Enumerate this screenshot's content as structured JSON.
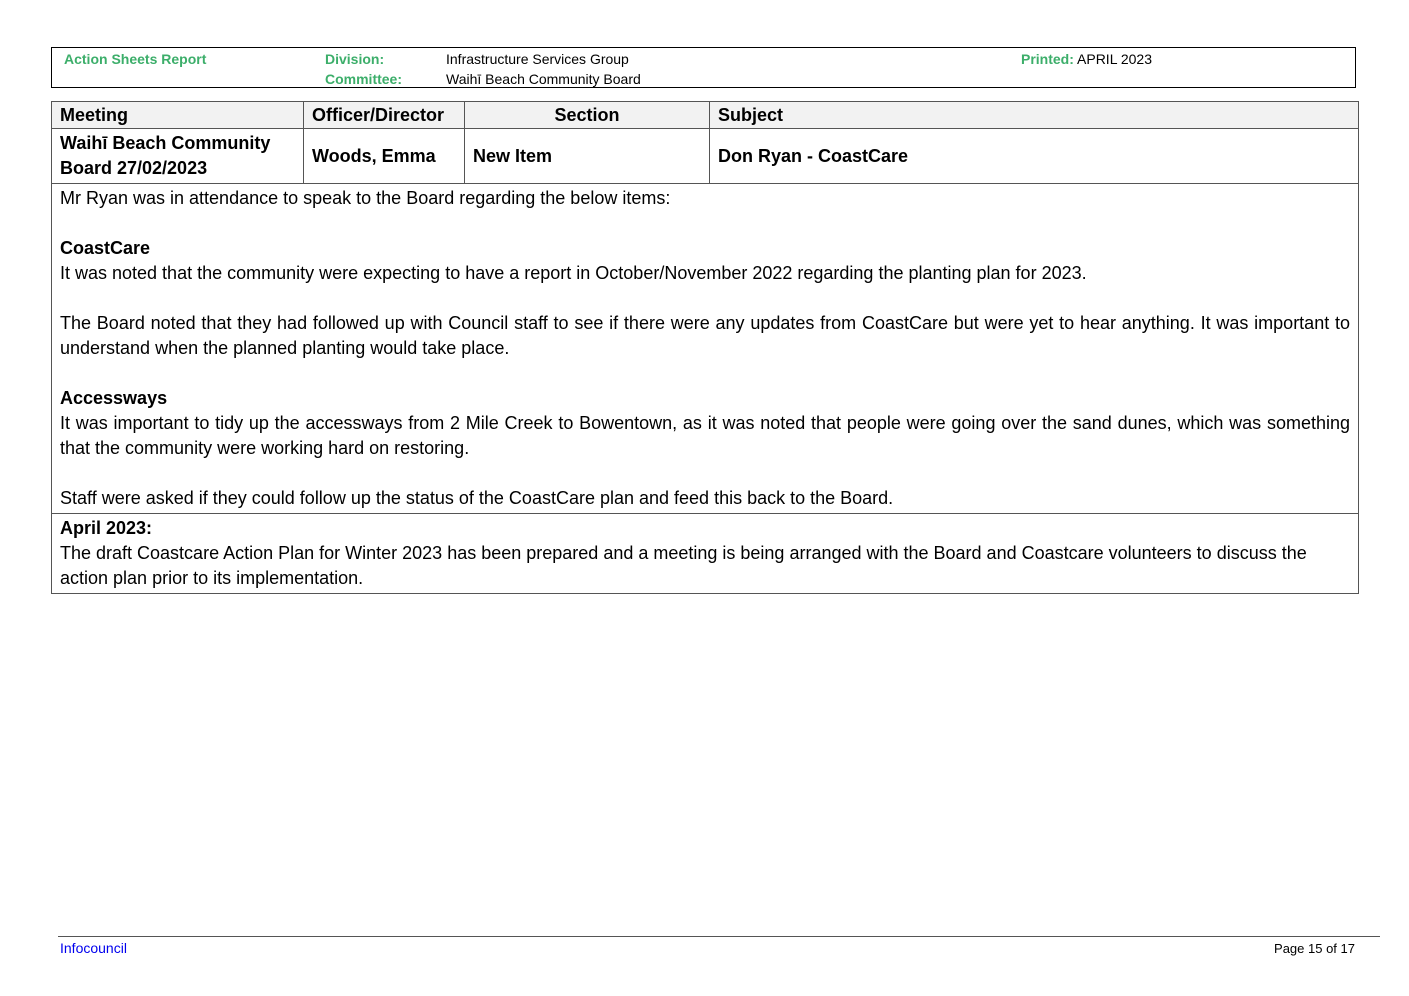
{
  "header": {
    "report_title": "Action Sheets Report",
    "division_label": "Division:",
    "division_value": "Infrastructure Services Group",
    "committee_label": "Committee:",
    "committee_value": "Waihī Beach Community Board",
    "printed_label": "Printed:",
    "printed_value": "APRIL 2023"
  },
  "table": {
    "columns": [
      "Meeting",
      "Officer/Director",
      "Section",
      "Subject"
    ],
    "row": {
      "meeting": "Waihī Beach Community Board 27/02/2023",
      "officer": "Woods, Emma",
      "section": "New Item",
      "subject": "Don Ryan - CoastCare"
    },
    "body": {
      "intro": "Mr Ryan was in attendance to speak to the Board regarding the below items:",
      "coastcare_heading": "CoastCare",
      "coastcare_p1": "It was noted that the community were expecting to have a report in October/November 2022 regarding the planting plan for 2023.",
      "coastcare_p2": "The Board noted that they had followed up with Council staff to see if there were any updates from CoastCare but were yet to hear anything. It was important to understand when the planned planting would take place.",
      "accessways_heading": "Accessways",
      "accessways_p1": "It was important to tidy up the accessways from 2 Mile Creek to Bowentown, as it was noted that people were going over the sand dunes, which was something that the community were working hard on restoring.",
      "accessways_p2": "Staff were asked if they could follow up the status of the CoastCare plan and feed this back to the Board."
    },
    "update": {
      "heading": "April 2023:",
      "text": "The draft Coastcare Action Plan for Winter 2023 has been prepared and a meeting is being arranged with the Board and Coastcare volunteers to discuss the action plan prior to its implementation."
    }
  },
  "footer": {
    "left": "Infocouncil",
    "right": "Page 15 of 17"
  }
}
